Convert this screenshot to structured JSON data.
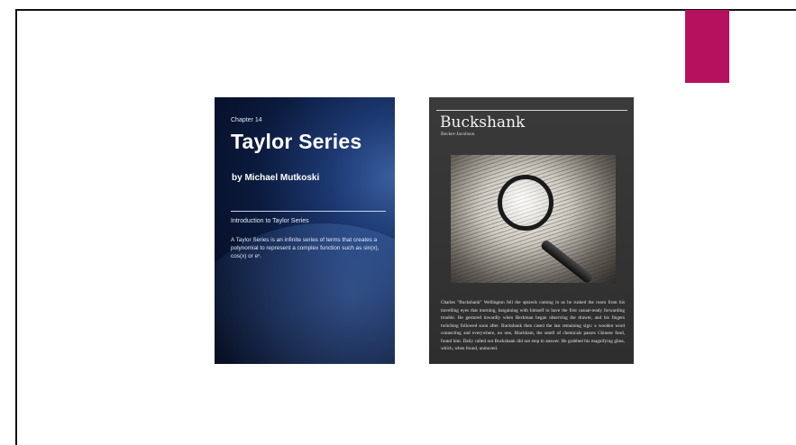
{
  "slide": {
    "accent_color": "#b5115e"
  },
  "books": [
    {
      "chapter": "Chapter 14",
      "title": "Taylor Series",
      "author": "by Michael Mutkoski",
      "subheading": "Introduction to Taylor Series",
      "description": "A Taylor Series is an infinite series of terms that creates a polynomial to represent a complex function such as sin(x), cos(x) or eˣ."
    },
    {
      "title": "Buckshank",
      "subtitle": "Becker-Jacobson",
      "body": "Charles \"Buckshank\" Wellington fell the sprawls coming in as he rushed the room from his travelling eyes that morning, bargaining with himself to have the first casual-ready forwarding trouble. He gestured inwardly when Beckman began observing the drawer, and his fingers twitching followed soon after. Buckshank then cased the last remaining sign: a wooden word connecting and everywhere, no one, Blackham, the smell of chemicals passes Chinese food, found him. Daily called out Buckshank did not stop to answer. He grabbed his magnifying glass, which, when found, unmoved."
    }
  ]
}
